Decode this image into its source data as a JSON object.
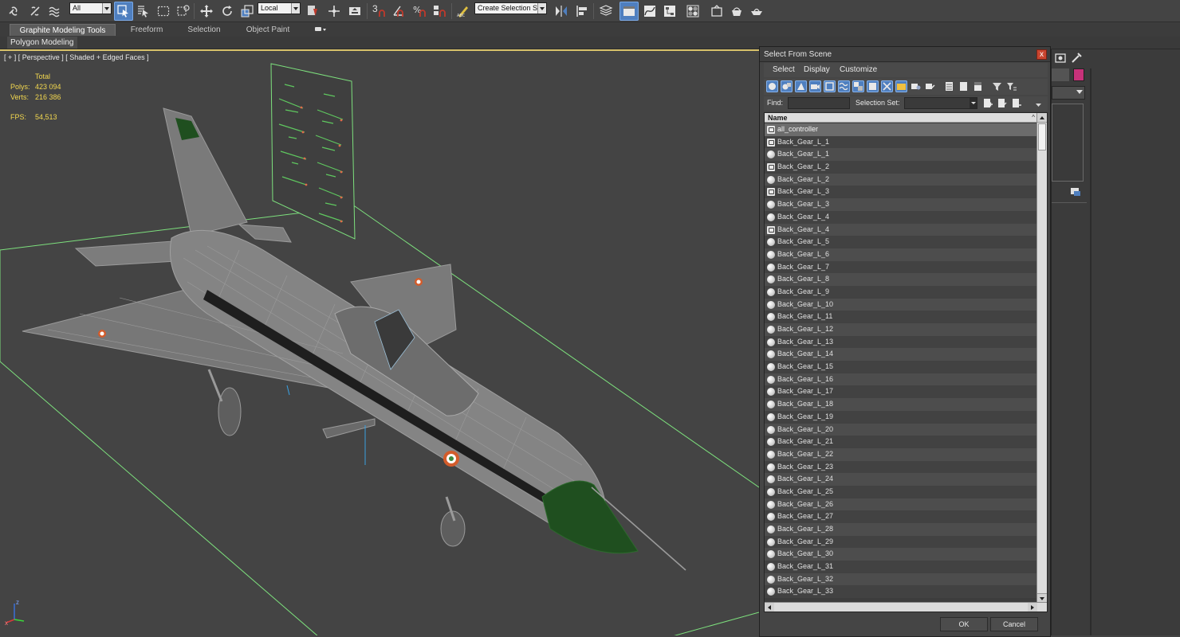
{
  "toolbar": {
    "selection_filter": "All",
    "reference_coordinate_system": "Local",
    "named_selection_set": "Create Selection Se",
    "snap_label": "3"
  },
  "ribbon": {
    "tabs": [
      "Graphite Modeling Tools",
      "Freeform",
      "Selection",
      "Object Paint"
    ],
    "panel_label": "Polygon Modeling"
  },
  "viewport": {
    "label": "[ + ] [ Perspective ] [ Shaded + Edged Faces ]",
    "stats": {
      "total_label": "Total",
      "polys_label": "Polys:",
      "polys_value": "423 094",
      "verts_label": "Verts:",
      "verts_value": "216 386",
      "fps_label": "FPS:",
      "fps_value": "54,513"
    },
    "axis_labels": {
      "z": "z",
      "x": "x"
    },
    "colors": {
      "background": "#444444",
      "stats": "#f3d84f",
      "helpers": "#7de07d",
      "mesh": "#8b8b8b",
      "nose_cone": "#1f4f1f"
    }
  },
  "dialog": {
    "title": "Select From Scene",
    "close_glyph": "x",
    "menu": [
      "Select",
      "Display",
      "Customize"
    ],
    "find_label": "Find:",
    "find_value": "",
    "selection_set_label": "Selection Set:",
    "column_header": "Name",
    "sort_glyph": "^",
    "items": [
      {
        "label": "all_controller",
        "icon": "helper-icon",
        "selected": true
      },
      {
        "label": "Back_Gear_L_1",
        "icon": "helper-icon",
        "selected": false
      },
      {
        "label": "Back_Gear_L_1",
        "icon": "geometry-icon",
        "selected": false
      },
      {
        "label": "Back_Gear_L_2",
        "icon": "helper-icon",
        "selected": false
      },
      {
        "label": "Back_Gear_L_2",
        "icon": "geometry-icon",
        "selected": false
      },
      {
        "label": "Back_Gear_L_3",
        "icon": "helper-icon",
        "selected": false
      },
      {
        "label": "Back_Gear_L_3",
        "icon": "geometry-icon",
        "selected": false
      },
      {
        "label": "Back_Gear_L_4",
        "icon": "geometry-icon",
        "selected": false
      },
      {
        "label": "Back_Gear_L_4",
        "icon": "helper-icon",
        "selected": false
      },
      {
        "label": "Back_Gear_L_5",
        "icon": "geometry-icon",
        "selected": false
      },
      {
        "label": "Back_Gear_L_6",
        "icon": "geometry-icon",
        "selected": false
      },
      {
        "label": "Back_Gear_L_7",
        "icon": "geometry-icon",
        "selected": false
      },
      {
        "label": "Back_Gear_L_8",
        "icon": "geometry-icon",
        "selected": false
      },
      {
        "label": "Back_Gear_L_9",
        "icon": "geometry-icon",
        "selected": false
      },
      {
        "label": "Back_Gear_L_10",
        "icon": "geometry-icon",
        "selected": false
      },
      {
        "label": "Back_Gear_L_11",
        "icon": "geometry-icon",
        "selected": false
      },
      {
        "label": "Back_Gear_L_12",
        "icon": "geometry-icon",
        "selected": false
      },
      {
        "label": "Back_Gear_L_13",
        "icon": "geometry-icon",
        "selected": false
      },
      {
        "label": "Back_Gear_L_14",
        "icon": "geometry-icon",
        "selected": false
      },
      {
        "label": "Back_Gear_L_15",
        "icon": "geometry-icon",
        "selected": false
      },
      {
        "label": "Back_Gear_L_16",
        "icon": "geometry-icon",
        "selected": false
      },
      {
        "label": "Back_Gear_L_17",
        "icon": "geometry-icon",
        "selected": false
      },
      {
        "label": "Back_Gear_L_18",
        "icon": "geometry-icon",
        "selected": false
      },
      {
        "label": "Back_Gear_L_19",
        "icon": "geometry-icon",
        "selected": false
      },
      {
        "label": "Back_Gear_L_20",
        "icon": "geometry-icon",
        "selected": false
      },
      {
        "label": "Back_Gear_L_21",
        "icon": "geometry-icon",
        "selected": false
      },
      {
        "label": "Back_Gear_L_22",
        "icon": "geometry-icon",
        "selected": false
      },
      {
        "label": "Back_Gear_L_23",
        "icon": "geometry-icon",
        "selected": false
      },
      {
        "label": "Back_Gear_L_24",
        "icon": "geometry-icon",
        "selected": false
      },
      {
        "label": "Back_Gear_L_25",
        "icon": "geometry-icon",
        "selected": false
      },
      {
        "label": "Back_Gear_L_26",
        "icon": "geometry-icon",
        "selected": false
      },
      {
        "label": "Back_Gear_L_27",
        "icon": "geometry-icon",
        "selected": false
      },
      {
        "label": "Back_Gear_L_28",
        "icon": "geometry-icon",
        "selected": false
      },
      {
        "label": "Back_Gear_L_29",
        "icon": "geometry-icon",
        "selected": false
      },
      {
        "label": "Back_Gear_L_30",
        "icon": "geometry-icon",
        "selected": false
      },
      {
        "label": "Back_Gear_L_31",
        "icon": "geometry-icon",
        "selected": false
      },
      {
        "label": "Back_Gear_L_32",
        "icon": "geometry-icon",
        "selected": false
      },
      {
        "label": "Back_Gear_L_33",
        "icon": "geometry-icon",
        "selected": false
      }
    ],
    "ok_label": "OK",
    "cancel_label": "Cancel"
  },
  "accent_colors": {
    "active_button": "#4f7fbf",
    "viewport_border": "#d8c26a",
    "swatch": "#c8327a"
  }
}
